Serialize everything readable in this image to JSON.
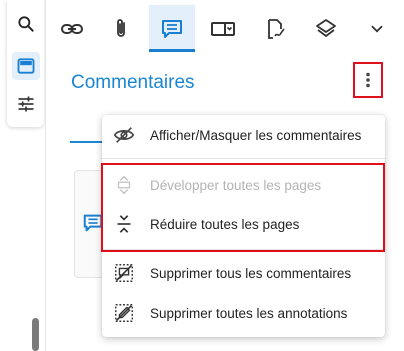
{
  "left_toolbar": {
    "items": [
      {
        "icon": "search-icon"
      },
      {
        "icon": "panel-icon",
        "active": true
      },
      {
        "icon": "sliders-icon"
      }
    ]
  },
  "top_toolbar": {
    "items": [
      {
        "icon": "link-icon"
      },
      {
        "icon": "paperclip-icon"
      },
      {
        "icon": "comment-icon",
        "active": true
      },
      {
        "icon": "form-field-icon"
      },
      {
        "icon": "signature-icon"
      },
      {
        "icon": "layers-icon"
      },
      {
        "icon": "chevron-down-icon"
      }
    ]
  },
  "panel": {
    "title": "Commentaires"
  },
  "menu": {
    "items": [
      {
        "label": "Afficher/Masquer les commentaires",
        "icon": "eye-off-icon",
        "enabled": true
      },
      {
        "label": "Développer toutes les pages",
        "icon": "expand-icon",
        "enabled": false
      },
      {
        "label": "Réduire toutes les pages",
        "icon": "collapse-icon",
        "enabled": true
      },
      {
        "label": "Supprimer tous les commentaires",
        "icon": "delete-comments-icon",
        "enabled": true
      },
      {
        "label": "Supprimer toutes les annotations",
        "icon": "delete-annotations-icon",
        "enabled": true
      }
    ]
  },
  "colors": {
    "accent": "#1a86d1",
    "highlight_box": "#e0101a"
  }
}
